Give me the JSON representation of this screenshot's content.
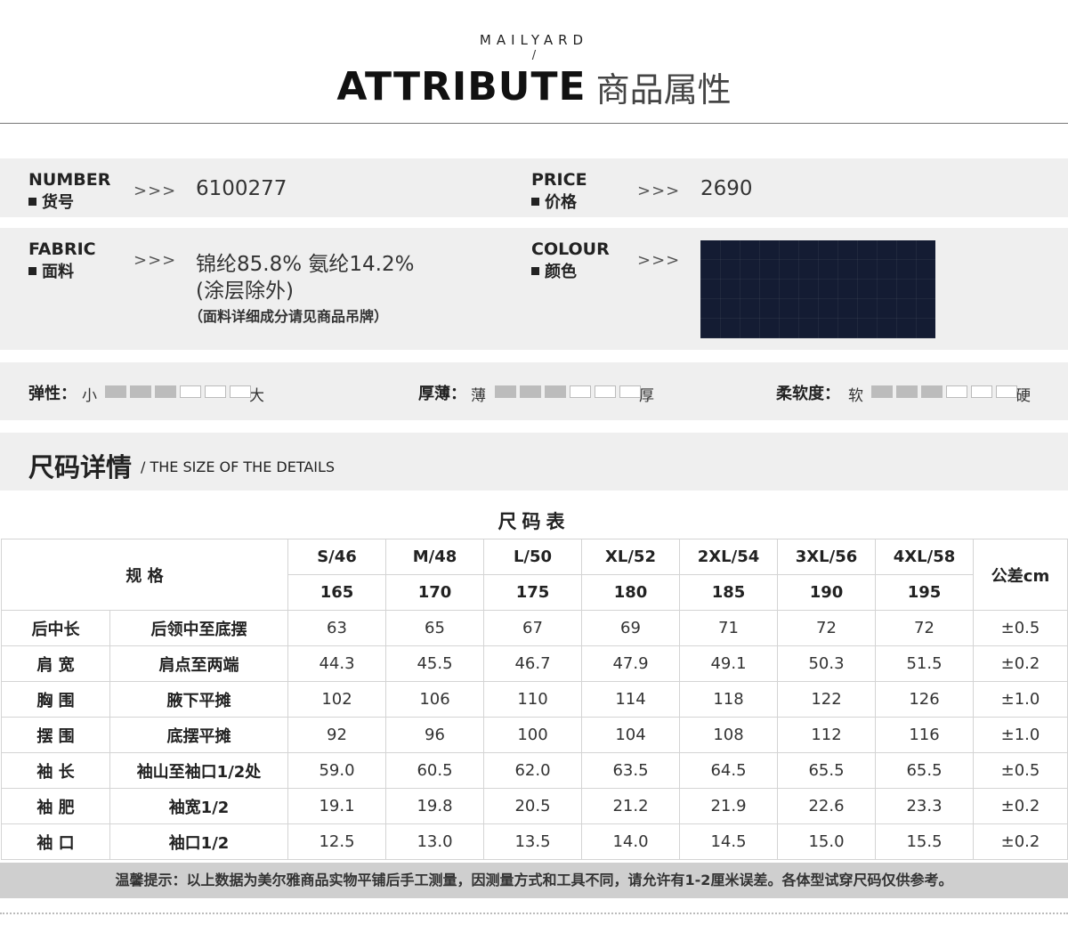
{
  "header": {
    "brand": "MAILYARD",
    "slash": "/",
    "title_en": "ATTRIBUTE",
    "title_cn": "商品属性"
  },
  "attributes": {
    "number": {
      "label_en": "NUMBER",
      "label_cn": "货号",
      "arrow": ">>>",
      "value": "6100277"
    },
    "price": {
      "label_en": "PRICE",
      "label_cn": "价格",
      "arrow": ">>>",
      "value": "2690"
    },
    "fabric": {
      "label_en": "FABRIC",
      "label_cn": "面料",
      "arrow": ">>>",
      "line1": "锦纶85.8% 氨纶14.2%",
      "line2": "(涂层除外)",
      "note": "（面料详细成分请见商品吊牌）"
    },
    "colour": {
      "label_en": "COLOUR",
      "label_cn": "颜色",
      "arrow": ">>>",
      "swatch_color": "#141c33"
    }
  },
  "scales": [
    {
      "label": "弹性：",
      "low": "小",
      "high": "大",
      "level": 3,
      "total": 6
    },
    {
      "label": "厚薄：",
      "low": "薄",
      "high": "厚",
      "level": 3,
      "total": 6
    },
    {
      "label": "柔软度：",
      "low": "软",
      "high": "硬",
      "level": 3,
      "total": 6
    }
  ],
  "size_section": {
    "title": "尺码详情",
    "subtitle": "/ THE SIZE OF THE DETAILS"
  },
  "size_table": {
    "title": "尺码表",
    "spec_label": "规 格",
    "tolerance_label": "公差cm",
    "sizes": [
      "S/46",
      "M/48",
      "L/50",
      "XL/52",
      "2XL/54",
      "3XL/56",
      "4XL/58"
    ],
    "heights": [
      "165",
      "170",
      "175",
      "180",
      "185",
      "190",
      "195"
    ],
    "rows": [
      {
        "name": "后中长",
        "method": "后领中至底摆",
        "values": [
          "63",
          "65",
          "67",
          "69",
          "71",
          "72",
          "72"
        ],
        "tol": "±0.5"
      },
      {
        "name": "肩 宽",
        "method": "肩点至两端",
        "values": [
          "44.3",
          "45.5",
          "46.7",
          "47.9",
          "49.1",
          "50.3",
          "51.5"
        ],
        "tol": "±0.2"
      },
      {
        "name": "胸 围",
        "method": "腋下平摊",
        "values": [
          "102",
          "106",
          "110",
          "114",
          "118",
          "122",
          "126"
        ],
        "tol": "±1.0"
      },
      {
        "name": "摆 围",
        "method": "底摆平摊",
        "values": [
          "92",
          "96",
          "100",
          "104",
          "108",
          "112",
          "116"
        ],
        "tol": "±1.0"
      },
      {
        "name": "袖 长",
        "method": "袖山至袖口1/2处",
        "values": [
          "59.0",
          "60.5",
          "62.0",
          "63.5",
          "64.5",
          "65.5",
          "65.5"
        ],
        "tol": "±0.5"
      },
      {
        "name": "袖 肥",
        "method": "袖宽1/2",
        "values": [
          "19.1",
          "19.8",
          "20.5",
          "21.2",
          "21.9",
          "22.6",
          "23.3"
        ],
        "tol": "±0.2"
      },
      {
        "name": "袖 口",
        "method": "袖口1/2",
        "values": [
          "12.5",
          "13.0",
          "13.5",
          "14.0",
          "14.5",
          "15.0",
          "15.5"
        ],
        "tol": "±0.2"
      }
    ]
  },
  "tip": "温馨提示：以上数据为美尔雅商品实物平铺后手工测量，因测量方式和工具不同，请允许有1-2厘米误差。各体型试穿尺码仅供参考。"
}
